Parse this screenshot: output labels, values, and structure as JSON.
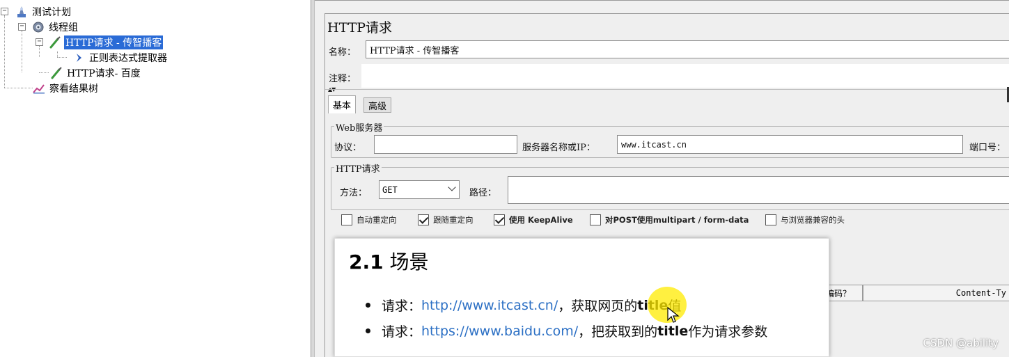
{
  "tree": {
    "nodes": [
      {
        "label": "测试计划",
        "icon": "test-plan-icon"
      },
      {
        "label": "线程组",
        "icon": "gear-icon"
      },
      {
        "label": "HTTP请求 - 传智播客",
        "icon": "pipette-icon",
        "selected": true
      },
      {
        "label": "正则表达式提取器",
        "icon": "arrow-icon"
      },
      {
        "label": "HTTP请求- 百度",
        "icon": "pipette-icon"
      },
      {
        "label": "察看结果树",
        "icon": "chart-icon"
      }
    ],
    "toggle_collapse": "−"
  },
  "panel": {
    "title": "HTTP请求",
    "name_label": "名称：",
    "name_value": "HTTP请求 - 传智播客",
    "comment_label": "注释：",
    "tabs": [
      "基本",
      "高级"
    ],
    "web_server": {
      "group_title": "Web服务器",
      "protocol_label": "协议：",
      "protocol_value": "",
      "server_label": "服务器名称或IP：",
      "server_value": "www.itcast.cn",
      "port_label": "端口号："
    },
    "http_request": {
      "group_title": "HTTP请求",
      "method_label": "方法：",
      "method_value": "GET",
      "path_label": "路径：",
      "path_value": ""
    },
    "checkboxes": [
      {
        "label": "自动重定向",
        "checked": false
      },
      {
        "label": "跟随重定向",
        "checked": true
      },
      {
        "label": "使用 KeepAlive",
        "checked": true
      },
      {
        "label": "对POST使用multipart / form-data",
        "checked": false
      },
      {
        "label": "与浏览器兼容的头",
        "checked": false
      }
    ],
    "table_headers": [
      "编码？",
      "Content-Ty"
    ]
  },
  "slide": {
    "title_num": "2.1",
    "title_text": "场景",
    "bullets": [
      {
        "prefix": "请求：",
        "link": "http://www.itcast.cn/",
        "middle": "，获取网页的",
        "bold": "title",
        "suffix": "值"
      },
      {
        "prefix": "请求：",
        "link": "https://www.baidu.com/",
        "middle": "，把获取到的",
        "bold": "title",
        "suffix": "作为请求参数"
      }
    ]
  },
  "watermark": "CSDN @ability",
  "colors": {
    "selection": "#2a6bd6",
    "link": "#2b6fc4",
    "highlight": "#ffeb00"
  }
}
